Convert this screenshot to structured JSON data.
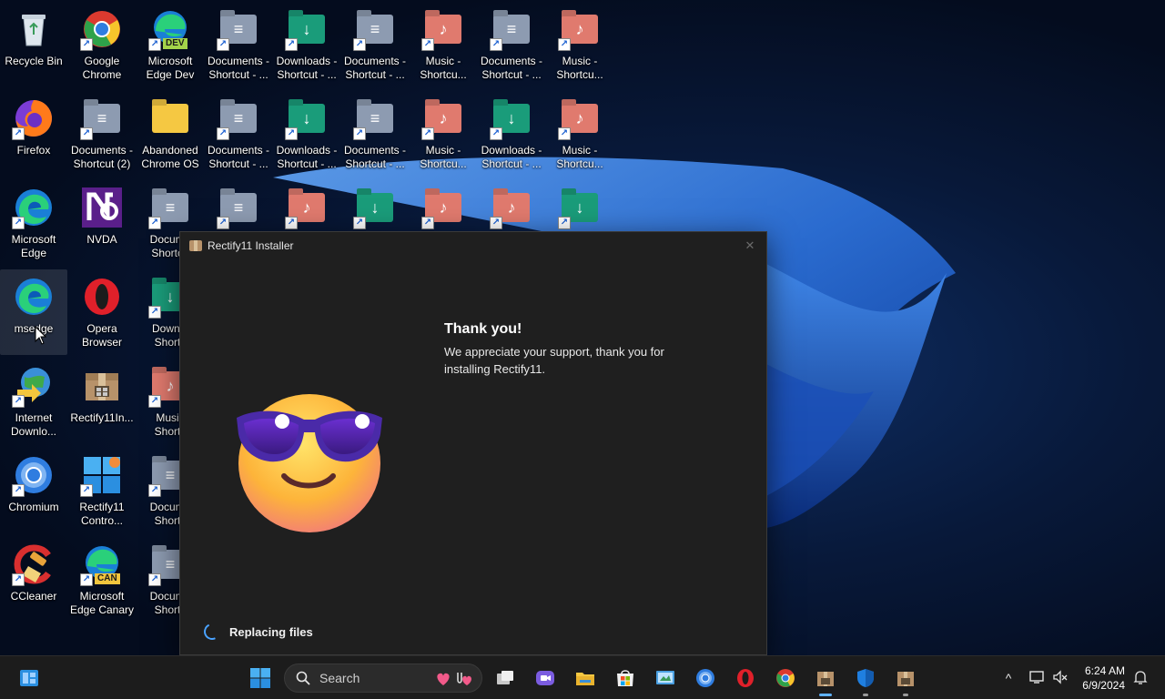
{
  "desktop": {
    "icons": [
      {
        "label": "Recycle Bin"
      },
      {
        "label": "Google\nChrome"
      },
      {
        "label": "Microsoft\nEdge Dev",
        "badge": "DEV"
      },
      {
        "label": "Documents -\nShortcut - ..."
      },
      {
        "label": "Downloads -\nShortcut - ..."
      },
      {
        "label": "Documents -\nShortcut - ..."
      },
      {
        "label": "Music -\nShortcu..."
      },
      {
        "label": "Documents -\nShortcut - ..."
      },
      {
        "label": "Music -\nShortcu..."
      },
      {
        "label": "Firefox"
      },
      {
        "label": "Documents -\nShortcut (2)"
      },
      {
        "label": "Abandoned\nChrome OS"
      },
      {
        "label": "Documents -\nShortcut - ..."
      },
      {
        "label": "Downloads -\nShortcut - ..."
      },
      {
        "label": "Documents -\nShortcut - ..."
      },
      {
        "label": "Music -\nShortcu..."
      },
      {
        "label": "Downloads -\nShortcut - ..."
      },
      {
        "label": "Music -\nShortcu..."
      },
      {
        "label": "Microsoft\nEdge"
      },
      {
        "label": "NVDA"
      },
      {
        "label": "Docume\nShortcu"
      },
      {
        "label": "msedge"
      },
      {
        "label": "Opera\nBrowser"
      },
      {
        "label": "Downlo\nShortc"
      },
      {
        "label": "Internet\nDownlo..."
      },
      {
        "label": "Rectify11In..."
      },
      {
        "label": "Music\nShortc"
      },
      {
        "label": "Chromium"
      },
      {
        "label": "Rectify11\nContro..."
      },
      {
        "label": "Docume\nShortc"
      },
      {
        "label": "CCleaner"
      },
      {
        "label": "Microsoft\nEdge Canary",
        "badge": "CAN"
      },
      {
        "label": "Docume\nShortc"
      }
    ]
  },
  "installer": {
    "title": "Rectify11 Installer",
    "close_glyph": "✕",
    "heading": "Thank you!",
    "message": "We appreciate your support, thank you for installing Rectify11.",
    "status": "Replacing files"
  },
  "taskbar": {
    "search_label": "Search",
    "time": "6:24 AM",
    "date": "6/9/2024",
    "tray_chevron": "^"
  },
  "colors": {
    "accent": "#5fb2ff",
    "window_bg": "#1f1f1f",
    "taskbar_bg": "#1c1c1c"
  }
}
